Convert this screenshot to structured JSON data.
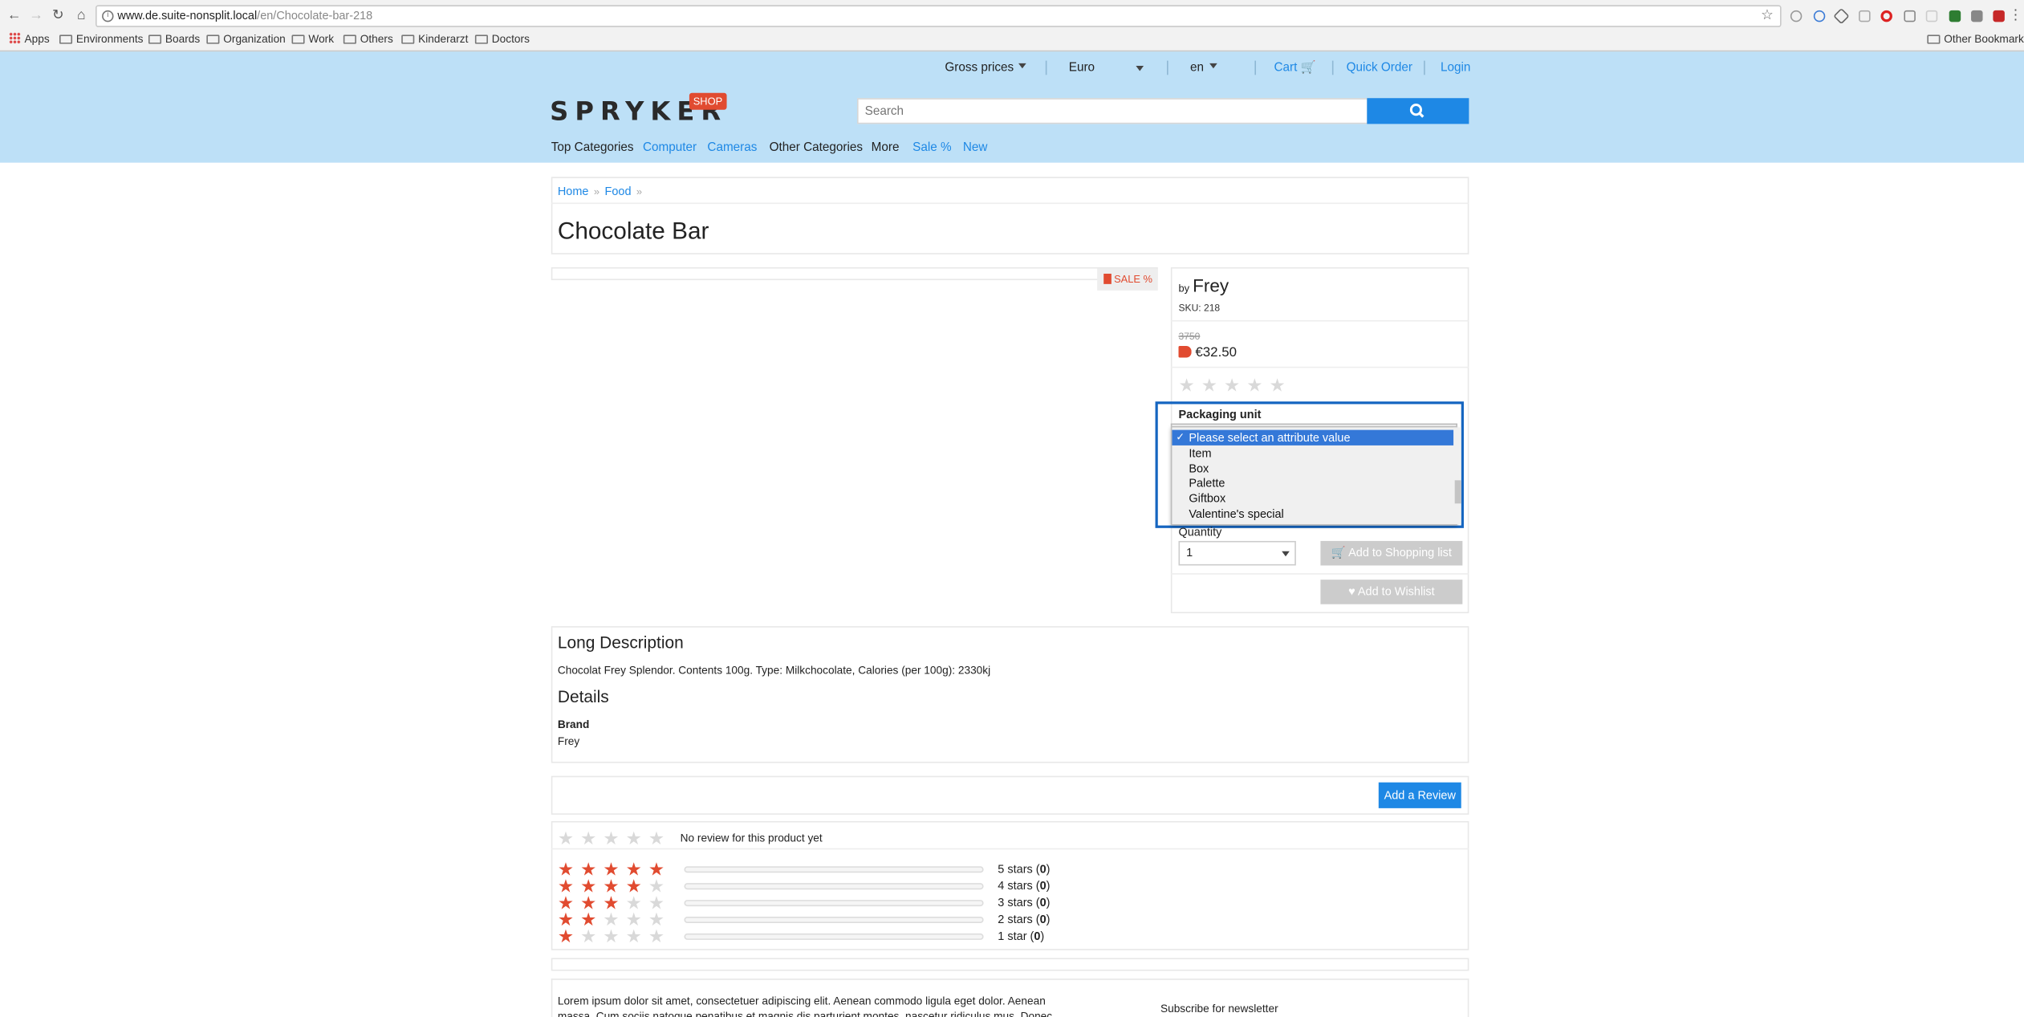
{
  "browser": {
    "url_host": "www.de.suite-nonsplit.local",
    "url_path": "/en/Chocolate-bar-218",
    "bookmarks": [
      "Apps",
      "Environments",
      "Boards",
      "Organization",
      "Work",
      "Others",
      "Kinderarzt",
      "Doctors"
    ],
    "other_bookmarks": "Other Bookmarks"
  },
  "header": {
    "price_mode": "Gross prices",
    "currency": "Euro",
    "language": "en",
    "cart": "Cart",
    "quick_order": "Quick Order",
    "login": "Login",
    "logo": "SPRYKER",
    "logo_badge": "SHOP",
    "search_placeholder": "Search",
    "categories": [
      "Top Categories",
      "Computer",
      "Cameras",
      "Other Categories",
      "More",
      "Sale %",
      "New"
    ]
  },
  "breadcrumb": [
    "Home",
    "Food"
  ],
  "product": {
    "title": "Chocolate Bar",
    "sale_badge": "SALE %",
    "by": "by",
    "brand": "Frey",
    "sku": "SKU: 218",
    "old_price": "3750",
    "price": "€32.50",
    "rating_stars": 0,
    "packaging_label": "Packaging unit",
    "packaging_options": [
      "Please select an attribute value",
      "Item",
      "Box",
      "Palette",
      "Giftbox",
      "Valentine's special"
    ],
    "packaging_selected": "Please select an attribute value",
    "quantity_label": "Quantity",
    "quantity_value": "1",
    "add_to_list": "Add to Shopping list",
    "add_to_wishlist": "Add to Wishlist"
  },
  "description": {
    "heading": "Long Description",
    "text": "Chocolat Frey Splendor. Contents 100g. Type: Milkchocolate, Calories (per 100g): 2330kj",
    "details_heading": "Details",
    "brand_label": "Brand",
    "brand_value": "Frey"
  },
  "reviews": {
    "add_review": "Add a Review",
    "no_review": "No review for this product yet",
    "breakdown": [
      {
        "label": "5 stars",
        "count": "0",
        "stars": 5
      },
      {
        "label": "4 stars",
        "count": "0",
        "stars": 4
      },
      {
        "label": "3 stars",
        "count": "0",
        "stars": 3
      },
      {
        "label": "2 stars",
        "count": "0",
        "stars": 2
      },
      {
        "label": "1 star",
        "count": "0",
        "stars": 1
      }
    ]
  },
  "footer": {
    "lorem_line1": "Lorem ipsum dolor sit amet, consectetuer adipiscing elit. Aenean commodo ligula eget dolor. Aenean",
    "lorem_line2": "massa. Cum sociis natoque penatibus et magnis dis parturient montes, nascetur ridiculus mus. Donec",
    "newsletter": "Subscribe for newsletter"
  },
  "colors": {
    "header_bg": "#bde0f7",
    "accent": "#1e88e5",
    "sale": "#e14b30"
  }
}
